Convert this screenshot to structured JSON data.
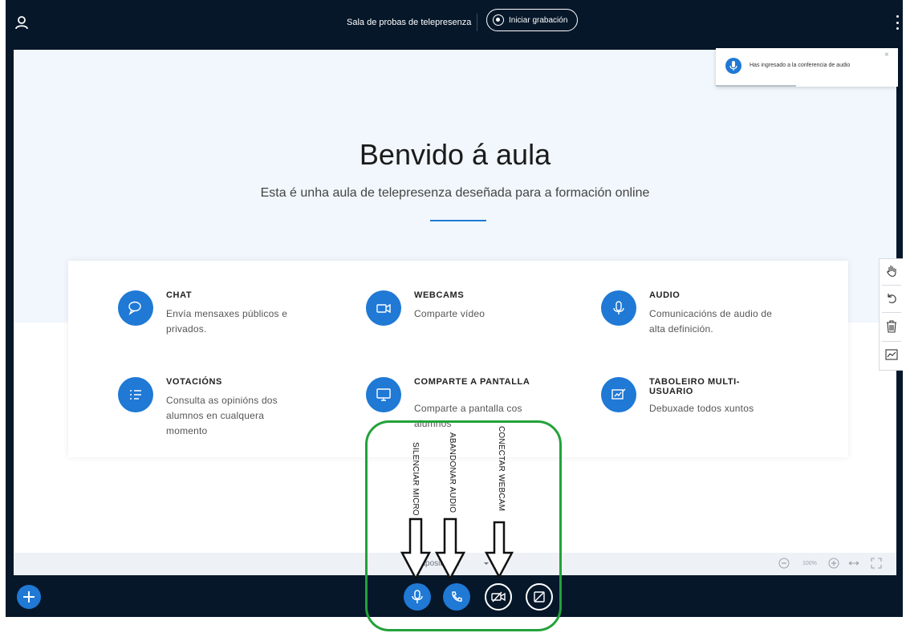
{
  "topbar": {
    "room_name": "Sala de probas de telepresenza",
    "record_label": "Iniciar grabación"
  },
  "notification": {
    "text": "Has ingresado a la conferencia de audio",
    "close": "×"
  },
  "slide": {
    "title": "Benvido á aula",
    "subtitle": "Esta é unha aula de telepresenza deseñada para a formación online",
    "features": [
      {
        "icon": "chat-icon",
        "title": "CHAT",
        "description": "Envía mensaxes públicos e privados."
      },
      {
        "icon": "webcam-icon",
        "title": "WEBCAMS",
        "description": "Comparte vídeo"
      },
      {
        "icon": "microphone-icon",
        "title": "AUDIO",
        "description": "Comunicacións de audio de alta definición."
      },
      {
        "icon": "poll-icon",
        "title": "VOTACIÓNS",
        "description": "Consulta as opinións dos alumnos en cualquera momento"
      },
      {
        "icon": "screen-share-icon",
        "title": "COMPARTE A PANTALLA",
        "description": "Comparte a pantalla cos alumnos"
      },
      {
        "icon": "whiteboard-icon",
        "title": "TABOLEIRO MULTI-USUARIO",
        "description": "Debuxade todos xuntos"
      }
    ]
  },
  "slide_controls": {
    "current_slide": "Diapositiva 1",
    "zoom": "100%"
  },
  "annotations": {
    "mute_mic": "SILENCIAR MICRO",
    "leave_audio": "ABANDONAR AUDIO",
    "connect_webcam": "CONECTAR WEBCAM"
  },
  "colors": {
    "topbar_bg": "#06172a",
    "accent": "#1f79d5",
    "annotation_green": "#22a23a",
    "slide_bg": "#f1f7fc"
  }
}
